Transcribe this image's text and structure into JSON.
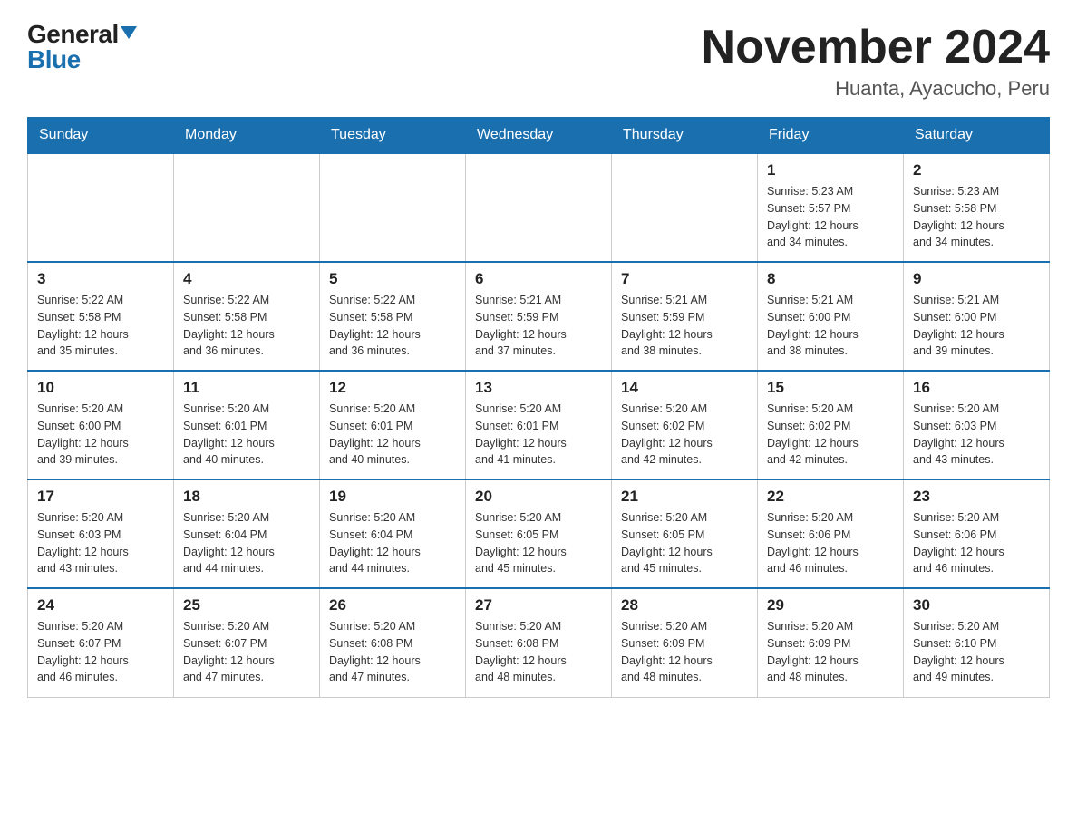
{
  "logo": {
    "general": "General",
    "blue": "Blue"
  },
  "title": "November 2024",
  "subtitle": "Huanta, Ayacucho, Peru",
  "days_header": [
    "Sunday",
    "Monday",
    "Tuesday",
    "Wednesday",
    "Thursday",
    "Friday",
    "Saturday"
  ],
  "weeks": [
    [
      {
        "day": "",
        "info": ""
      },
      {
        "day": "",
        "info": ""
      },
      {
        "day": "",
        "info": ""
      },
      {
        "day": "",
        "info": ""
      },
      {
        "day": "",
        "info": ""
      },
      {
        "day": "1",
        "info": "Sunrise: 5:23 AM\nSunset: 5:57 PM\nDaylight: 12 hours\nand 34 minutes."
      },
      {
        "day": "2",
        "info": "Sunrise: 5:23 AM\nSunset: 5:58 PM\nDaylight: 12 hours\nand 34 minutes."
      }
    ],
    [
      {
        "day": "3",
        "info": "Sunrise: 5:22 AM\nSunset: 5:58 PM\nDaylight: 12 hours\nand 35 minutes."
      },
      {
        "day": "4",
        "info": "Sunrise: 5:22 AM\nSunset: 5:58 PM\nDaylight: 12 hours\nand 36 minutes."
      },
      {
        "day": "5",
        "info": "Sunrise: 5:22 AM\nSunset: 5:58 PM\nDaylight: 12 hours\nand 36 minutes."
      },
      {
        "day": "6",
        "info": "Sunrise: 5:21 AM\nSunset: 5:59 PM\nDaylight: 12 hours\nand 37 minutes."
      },
      {
        "day": "7",
        "info": "Sunrise: 5:21 AM\nSunset: 5:59 PM\nDaylight: 12 hours\nand 38 minutes."
      },
      {
        "day": "8",
        "info": "Sunrise: 5:21 AM\nSunset: 6:00 PM\nDaylight: 12 hours\nand 38 minutes."
      },
      {
        "day": "9",
        "info": "Sunrise: 5:21 AM\nSunset: 6:00 PM\nDaylight: 12 hours\nand 39 minutes."
      }
    ],
    [
      {
        "day": "10",
        "info": "Sunrise: 5:20 AM\nSunset: 6:00 PM\nDaylight: 12 hours\nand 39 minutes."
      },
      {
        "day": "11",
        "info": "Sunrise: 5:20 AM\nSunset: 6:01 PM\nDaylight: 12 hours\nand 40 minutes."
      },
      {
        "day": "12",
        "info": "Sunrise: 5:20 AM\nSunset: 6:01 PM\nDaylight: 12 hours\nand 40 minutes."
      },
      {
        "day": "13",
        "info": "Sunrise: 5:20 AM\nSunset: 6:01 PM\nDaylight: 12 hours\nand 41 minutes."
      },
      {
        "day": "14",
        "info": "Sunrise: 5:20 AM\nSunset: 6:02 PM\nDaylight: 12 hours\nand 42 minutes."
      },
      {
        "day": "15",
        "info": "Sunrise: 5:20 AM\nSunset: 6:02 PM\nDaylight: 12 hours\nand 42 minutes."
      },
      {
        "day": "16",
        "info": "Sunrise: 5:20 AM\nSunset: 6:03 PM\nDaylight: 12 hours\nand 43 minutes."
      }
    ],
    [
      {
        "day": "17",
        "info": "Sunrise: 5:20 AM\nSunset: 6:03 PM\nDaylight: 12 hours\nand 43 minutes."
      },
      {
        "day": "18",
        "info": "Sunrise: 5:20 AM\nSunset: 6:04 PM\nDaylight: 12 hours\nand 44 minutes."
      },
      {
        "day": "19",
        "info": "Sunrise: 5:20 AM\nSunset: 6:04 PM\nDaylight: 12 hours\nand 44 minutes."
      },
      {
        "day": "20",
        "info": "Sunrise: 5:20 AM\nSunset: 6:05 PM\nDaylight: 12 hours\nand 45 minutes."
      },
      {
        "day": "21",
        "info": "Sunrise: 5:20 AM\nSunset: 6:05 PM\nDaylight: 12 hours\nand 45 minutes."
      },
      {
        "day": "22",
        "info": "Sunrise: 5:20 AM\nSunset: 6:06 PM\nDaylight: 12 hours\nand 46 minutes."
      },
      {
        "day": "23",
        "info": "Sunrise: 5:20 AM\nSunset: 6:06 PM\nDaylight: 12 hours\nand 46 minutes."
      }
    ],
    [
      {
        "day": "24",
        "info": "Sunrise: 5:20 AM\nSunset: 6:07 PM\nDaylight: 12 hours\nand 46 minutes."
      },
      {
        "day": "25",
        "info": "Sunrise: 5:20 AM\nSunset: 6:07 PM\nDaylight: 12 hours\nand 47 minutes."
      },
      {
        "day": "26",
        "info": "Sunrise: 5:20 AM\nSunset: 6:08 PM\nDaylight: 12 hours\nand 47 minutes."
      },
      {
        "day": "27",
        "info": "Sunrise: 5:20 AM\nSunset: 6:08 PM\nDaylight: 12 hours\nand 48 minutes."
      },
      {
        "day": "28",
        "info": "Sunrise: 5:20 AM\nSunset: 6:09 PM\nDaylight: 12 hours\nand 48 minutes."
      },
      {
        "day": "29",
        "info": "Sunrise: 5:20 AM\nSunset: 6:09 PM\nDaylight: 12 hours\nand 48 minutes."
      },
      {
        "day": "30",
        "info": "Sunrise: 5:20 AM\nSunset: 6:10 PM\nDaylight: 12 hours\nand 49 minutes."
      }
    ]
  ]
}
